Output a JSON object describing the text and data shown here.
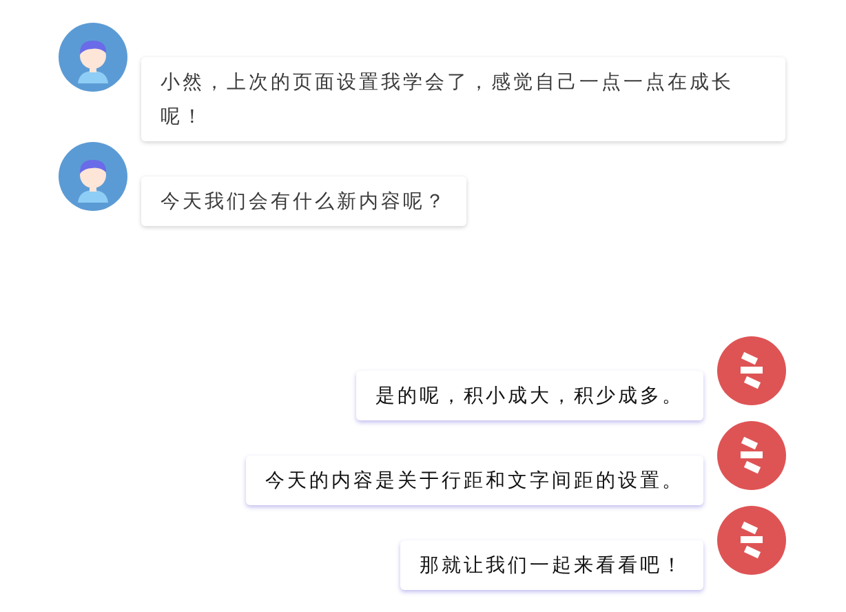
{
  "messages": [
    {
      "kind": "user",
      "text": "小然，上次的页面设置我学会了，感觉自己一点一点在成长呢！"
    },
    {
      "kind": "user",
      "text": "今天我们会有什么新内容呢？"
    },
    {
      "kind": "bot",
      "text": "是的呢，积小成大，积少成多。"
    },
    {
      "kind": "bot",
      "text": "今天的内容是关于行距和文字间距的设置。"
    },
    {
      "kind": "bot",
      "text": "那就让我们一起来看看吧！"
    }
  ]
}
